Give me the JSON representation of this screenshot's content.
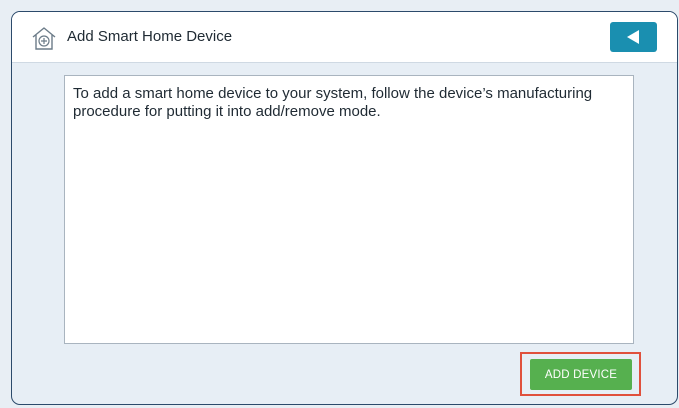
{
  "header": {
    "title": "Add Smart Home Device",
    "icon": "add-home-icon",
    "back_icon": "back-arrow-icon"
  },
  "message": {
    "text": "To add a smart home device to your system, follow the device’s manufacturing procedure for putting it into add/remove mode."
  },
  "actions": {
    "add_device_label": "ADD DEVICE"
  },
  "colors": {
    "accent": "#1a8fb0",
    "add_button": "#56b04f",
    "highlight": "#e0503c",
    "frame": "#2c4a6b"
  }
}
